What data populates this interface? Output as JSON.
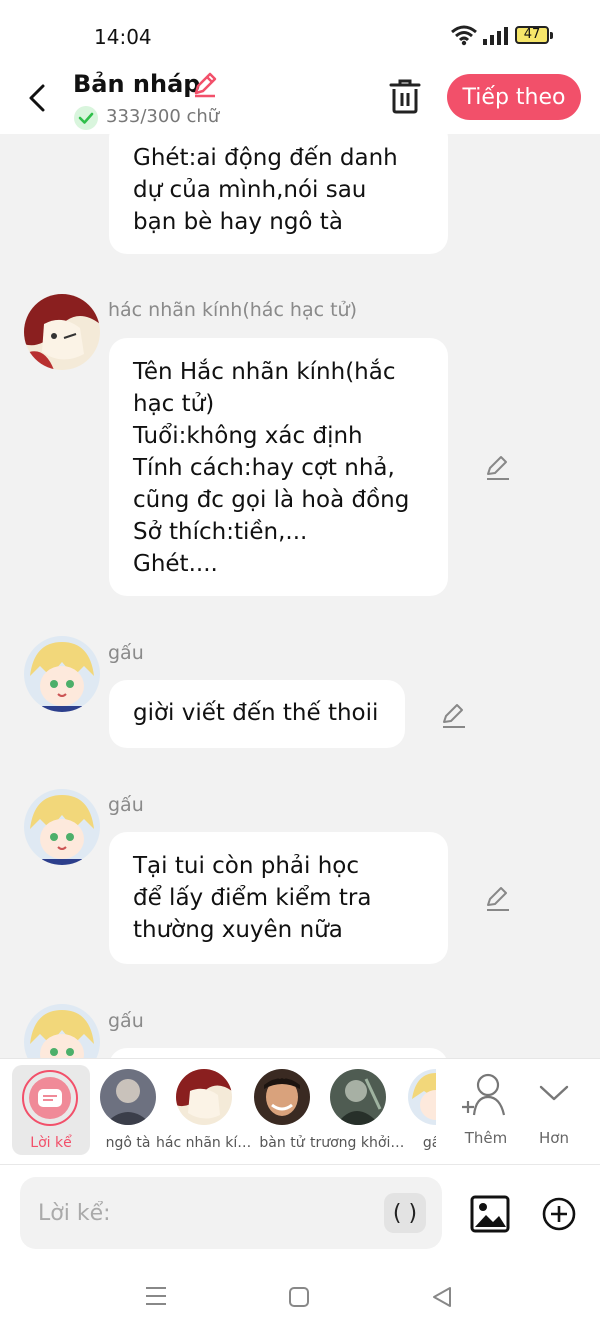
{
  "status_bar": {
    "time": "14:04",
    "battery": "47"
  },
  "header": {
    "title": "Bản nháp",
    "word_count": "333/300 chữ",
    "next_label": "Tiếp theo"
  },
  "messages": [
    {
      "sender": "",
      "text": "Ghét:ai động đến danh\ndự của mình,nói sau\nbạn bè hay ngô tà"
    },
    {
      "sender": "hác nhãn kính(hác hạc tử)",
      "text": "Tên Hắc nhãn kính(hắc\nhạc tử)\nTuổi:không xác định\nTính cách:hay cợt nhả,\ncũng đc gọi là hoà đồng\nSở thích:tiền,...\nGhét...."
    },
    {
      "sender": "gấu",
      "text": "giời viết đến thế thoii"
    },
    {
      "sender": "gấu",
      "text": "Tại tui còn phải học\nđể lấy điểm kiểm tra\nthường xuyên nữa"
    },
    {
      "sender": "gấu",
      "text": ""
    }
  ],
  "character_bar": {
    "narration_label": "Lời kể",
    "characters": [
      {
        "name": "ngô tà"
      },
      {
        "name": "hác nhãn kính(hác hạc tử)"
      },
      {
        "name": "bàn tử"
      },
      {
        "name": "trương khởi linh"
      },
      {
        "name": "gấu"
      }
    ],
    "add_label": "Thêm",
    "more_label": "Hơn"
  },
  "input": {
    "placeholder": "Lời kể:",
    "parentheses": "( )"
  },
  "colors": {
    "accent": "#f2506a",
    "background": "#f2f2f2",
    "bubble": "#ffffff",
    "secondary_text": "#8a8a8a"
  },
  "icons": [
    "back-icon",
    "pencil-icon",
    "check-icon",
    "trash-icon",
    "edit-icon",
    "user-plus-icon",
    "chevron-down-icon",
    "image-icon",
    "plus-circle-icon",
    "menu-icon",
    "home-icon",
    "back-triangle-icon"
  ]
}
